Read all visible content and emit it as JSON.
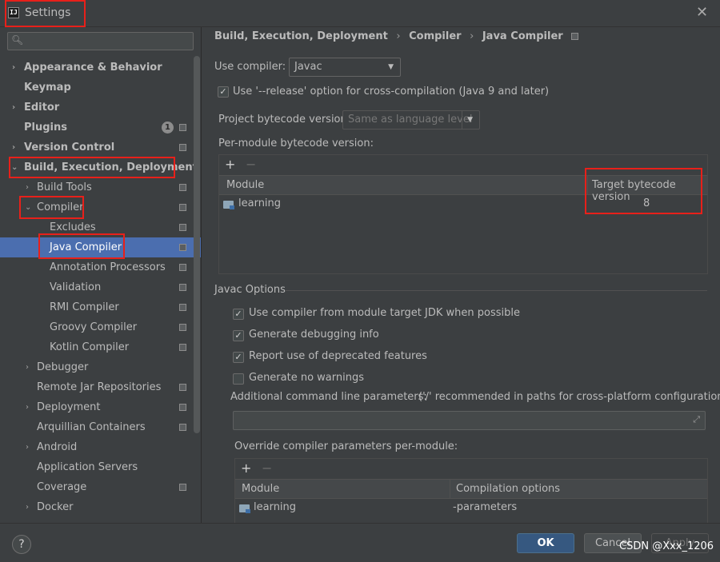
{
  "window": {
    "title": "Settings",
    "app_icon_text": "IJ"
  },
  "sidebar": {
    "search_placeholder": "",
    "items": [
      {
        "label": "Appearance & Behavior",
        "arrow": "›",
        "bold": true
      },
      {
        "label": "Keymap",
        "bold": true
      },
      {
        "label": "Editor",
        "arrow": "›",
        "bold": true
      },
      {
        "label": "Plugins",
        "bold": true,
        "badge": "1"
      },
      {
        "label": "Version Control",
        "arrow": "›",
        "bold": true
      },
      {
        "label": "Build, Execution, Deployment",
        "arrow": "⌄",
        "bold": true
      },
      {
        "label": "Build Tools",
        "arrow": "›"
      },
      {
        "label": "Compiler",
        "arrow": "⌄"
      },
      {
        "label": "Excludes"
      },
      {
        "label": "Java Compiler",
        "selected": true
      },
      {
        "label": "Annotation Processors"
      },
      {
        "label": "Validation"
      },
      {
        "label": "RMI Compiler"
      },
      {
        "label": "Groovy Compiler"
      },
      {
        "label": "Kotlin Compiler"
      },
      {
        "label": "Debugger",
        "arrow": "›"
      },
      {
        "label": "Remote Jar Repositories"
      },
      {
        "label": "Deployment",
        "arrow": "›"
      },
      {
        "label": "Arquillian Containers"
      },
      {
        "label": "Android",
        "arrow": "›"
      },
      {
        "label": "Application Servers"
      },
      {
        "label": "Coverage"
      },
      {
        "label": "Docker",
        "arrow": "›"
      }
    ]
  },
  "breadcrumb": {
    "part1": "Build, Execution, Deployment",
    "part2": "Compiler",
    "part3": "Java Compiler",
    "separator": "›"
  },
  "compiler": {
    "use_compiler_label": "Use compiler:",
    "use_compiler_value": "Javac",
    "release_option_label": "Use '--release' option for cross-compilation (Java 9 and later)",
    "release_option_checked": true,
    "project_bytecode_label": "Project bytecode version:",
    "project_bytecode_value": "Same as language level",
    "per_module_label": "Per-module bytecode version:",
    "per_module_table": {
      "headers": [
        "Module",
        "Target bytecode version"
      ],
      "rows": [
        {
          "module": "learning",
          "version": "8"
        }
      ]
    }
  },
  "javac_options": {
    "section_title": "Javac Options",
    "checkboxes": [
      {
        "label": "Use compiler from module target JDK when possible",
        "checked": true
      },
      {
        "label": "Generate debugging info",
        "checked": true
      },
      {
        "label": "Report use of deprecated features",
        "checked": true
      },
      {
        "label": "Generate no warnings",
        "checked": false
      }
    ],
    "additional_params_label": "Additional command line parameters:",
    "additional_params_hint": "('/' recommended in paths for cross-platform configurations)",
    "additional_params_value": "",
    "override_label": "Override compiler parameters per-module:",
    "override_table": {
      "headers": [
        "Module",
        "Compilation options"
      ],
      "rows": [
        {
          "module": "learning",
          "options": "-parameters"
        }
      ]
    }
  },
  "toolbar": {
    "add": "+",
    "remove": "−"
  },
  "footer": {
    "help": "?",
    "ok": "OK",
    "cancel": "Cancel",
    "apply": "Apply"
  },
  "watermark": "CSDN @Xxx_1206",
  "colors": {
    "accent": "#4b6eaf",
    "primary_button": "#365880",
    "annotation_box": "#e8201a"
  }
}
